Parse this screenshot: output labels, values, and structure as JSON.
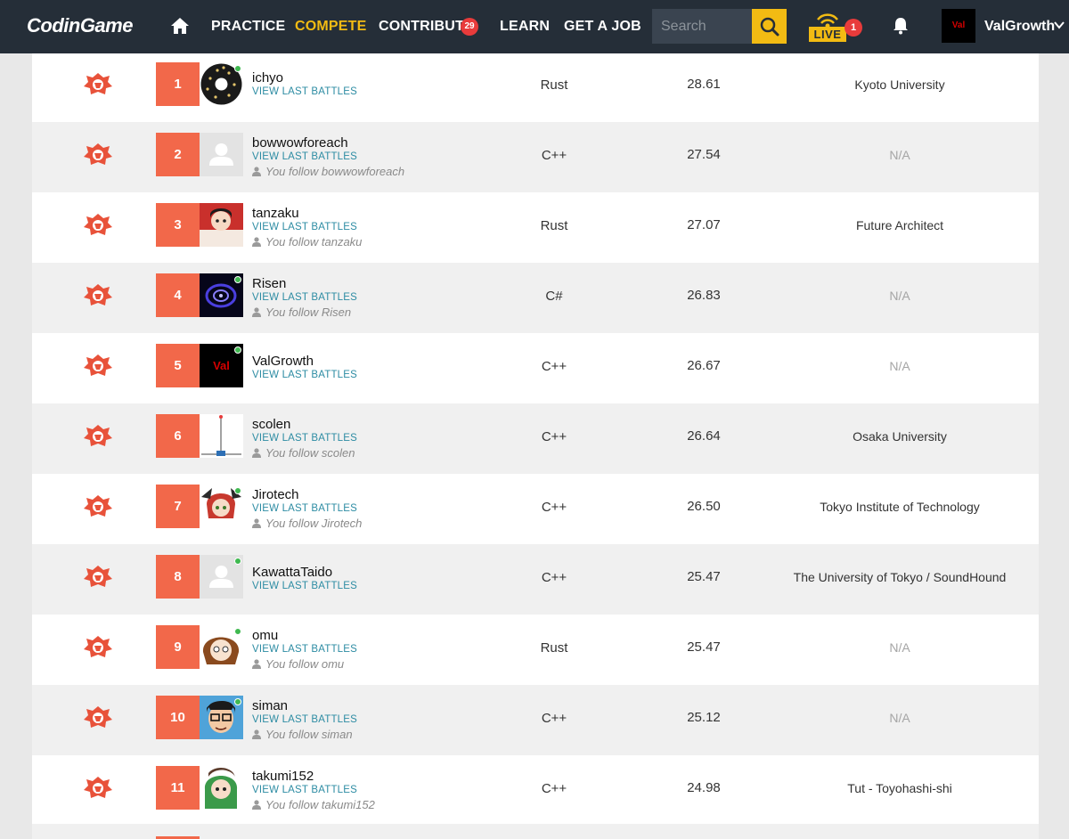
{
  "nav": {
    "logo_text": "CodinGame",
    "items": [
      {
        "label": "PRACTICE",
        "active": false
      },
      {
        "label": "COMPETE",
        "active": true
      },
      {
        "label": "CONTRIBUTE",
        "active": false
      },
      {
        "label": "LEARN",
        "active": false
      },
      {
        "label": "GET A JOB",
        "active": false
      }
    ],
    "contribute_badge": "29",
    "search_placeholder": "Search",
    "live_label": "LIVE",
    "live_badge": "1",
    "avatar_text": "Val",
    "username": "ValGrowth",
    "accent_color": "#f2bb13",
    "background_color": "#252e38"
  },
  "leaderboard": {
    "view_battles_label": "VIEW LAST BATTLES",
    "follow_prefix": "You follow ",
    "rank_color": "#f2684a",
    "link_color": "#2d8ca3",
    "rows": [
      {
        "rank": "1",
        "name": "ichyo",
        "follow": "",
        "language": "Rust",
        "score": "28.61",
        "organization": "Kyoto University",
        "online": true,
        "avatar": "donut-icon"
      },
      {
        "rank": "2",
        "name": "bowwowforeach",
        "follow": "You follow bowwowforeach",
        "language": "C++",
        "score": "27.54",
        "organization": "N/A",
        "online": false,
        "avatar": "default-user-icon"
      },
      {
        "rank": "3",
        "name": "tanzaku",
        "follow": "You follow tanzaku",
        "language": "Rust",
        "score": "27.07",
        "organization": "Future Architect",
        "online": false,
        "avatar": "anime-avatar"
      },
      {
        "rank": "4",
        "name": "Risen",
        "follow": "You follow Risen",
        "language": "C#",
        "score": "26.83",
        "organization": "N/A",
        "online": true,
        "avatar": "blue-swirl-avatar"
      },
      {
        "rank": "5",
        "name": "ValGrowth",
        "follow": "",
        "language": "C++",
        "score": "26.67",
        "organization": "N/A",
        "online": true,
        "avatar_text": "Val"
      },
      {
        "rank": "6",
        "name": "scolen",
        "follow": "You follow scolen",
        "language": "C++",
        "score": "26.64",
        "organization": "Osaka University",
        "online": false,
        "avatar": "pendulum-avatar"
      },
      {
        "rank": "7",
        "name": "Jirotech",
        "follow": "You follow Jirotech",
        "language": "C++",
        "score": "26.50",
        "organization": "Tokyo Institute of Technology",
        "online": true,
        "avatar": "anime-avatar"
      },
      {
        "rank": "8",
        "name": "KawattaTaido",
        "follow": "",
        "language": "C++",
        "score": "25.47",
        "organization": "The University of Tokyo / SoundHound",
        "online": true,
        "avatar": "default-user-icon"
      },
      {
        "rank": "9",
        "name": "omu",
        "follow": "You follow omu",
        "language": "Rust",
        "score": "25.47",
        "organization": "N/A",
        "online": true,
        "avatar": "anime-avatar"
      },
      {
        "rank": "10",
        "name": "siman",
        "follow": "You follow siman",
        "language": "C++",
        "score": "25.12",
        "organization": "N/A",
        "online": true,
        "avatar": "glasses-avatar"
      },
      {
        "rank": "11",
        "name": "takumi152",
        "follow": "You follow takumi152",
        "language": "C++",
        "score": "24.98",
        "organization": "Tut - Toyohashi-shi",
        "online": false,
        "avatar": "anime-avatar"
      }
    ]
  }
}
